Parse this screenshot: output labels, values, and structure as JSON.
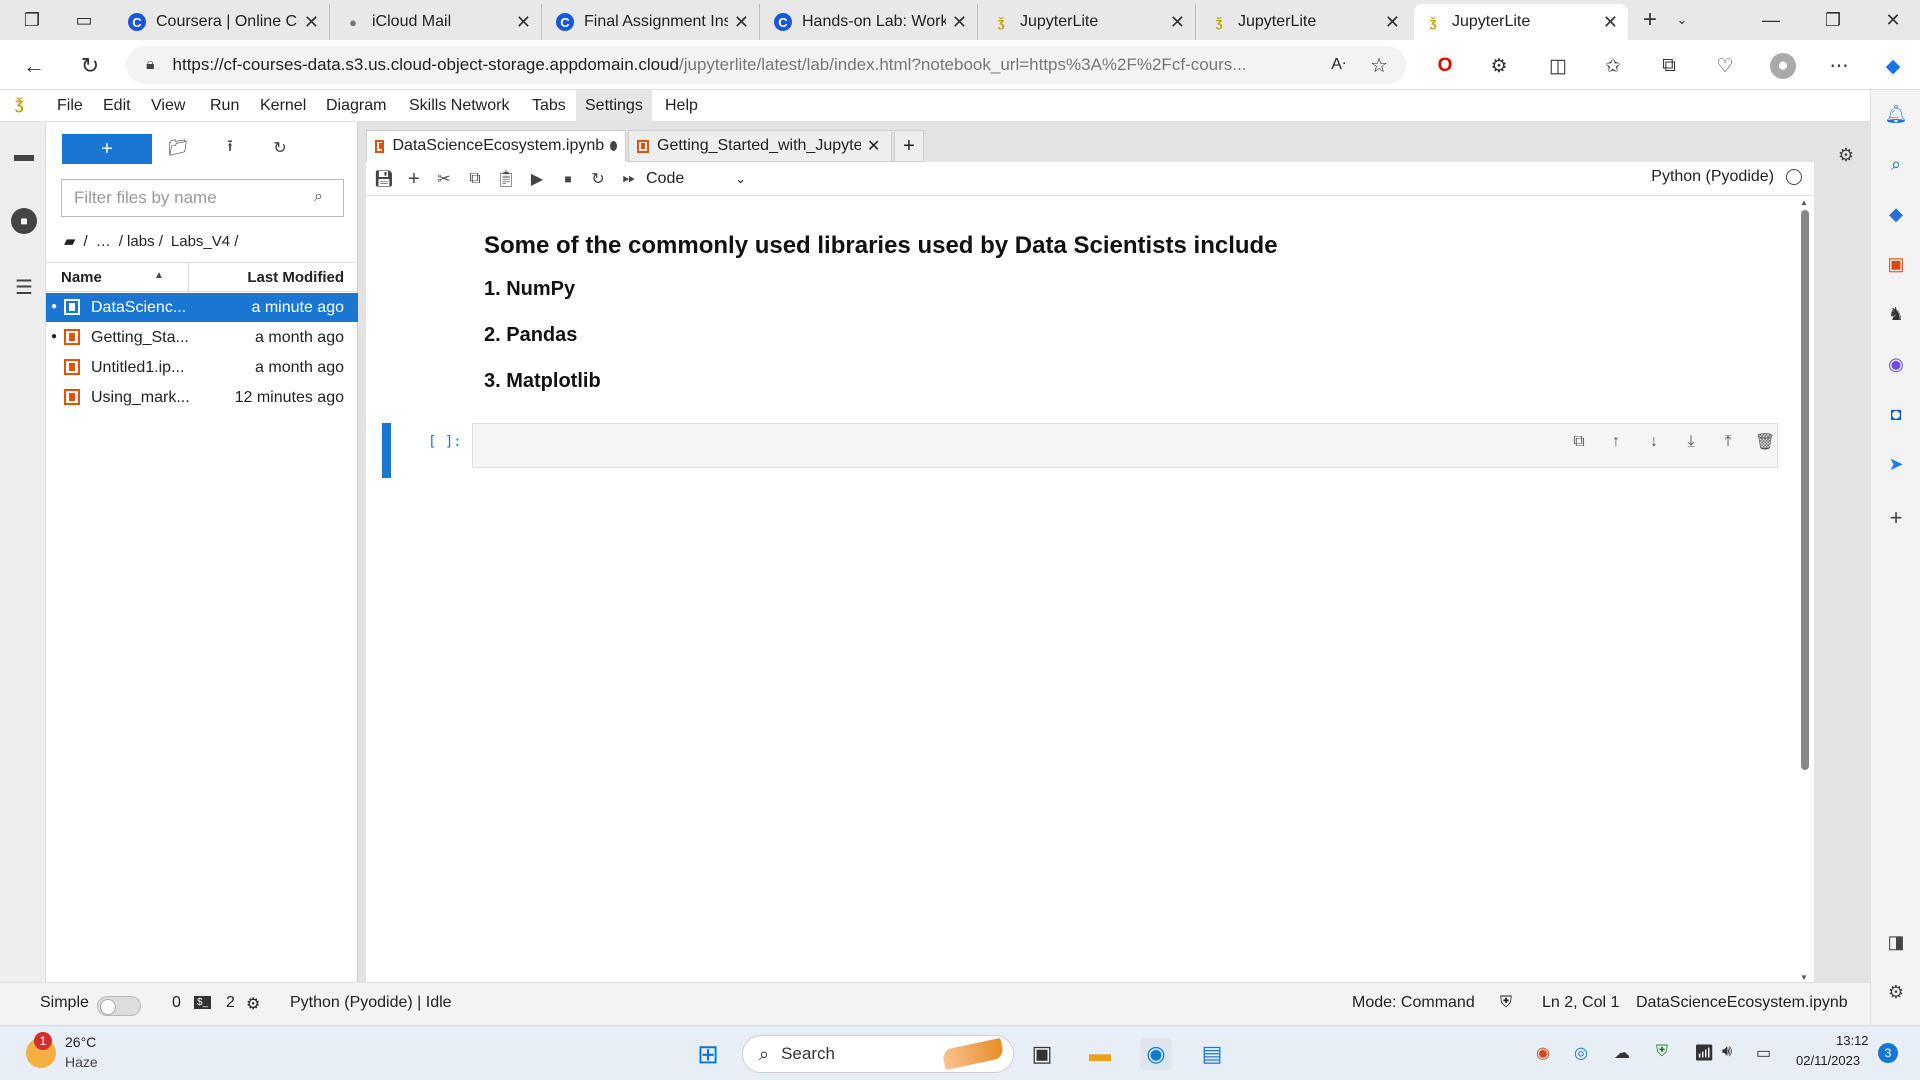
{
  "browser": {
    "tabs": [
      {
        "title": "Coursera | Online Cc",
        "favicon": "coursera-icon"
      },
      {
        "title": "iCloud Mail",
        "favicon": "apple-icon"
      },
      {
        "title": "Final Assignment Ins",
        "favicon": "coursera-icon"
      },
      {
        "title": "Hands-on Lab: Work",
        "favicon": "coursera-icon"
      },
      {
        "title": "JupyterLite",
        "favicon": "jupyter-icon"
      },
      {
        "title": "JupyterLite",
        "favicon": "jupyter-icon"
      },
      {
        "title": "JupyterLite",
        "favicon": "jupyter-icon",
        "active": true
      }
    ],
    "url_main": "https://cf-courses-data.s3.us.cloud-object-storage.appdomain.cloud",
    "url_rest": "/jupyterlite/latest/lab/index.html?notebook_url=https%3A%2F%2Fcf-cours..."
  },
  "jupyter": {
    "menu": [
      "File",
      "Edit",
      "View",
      "Run",
      "Kernel",
      "Diagram",
      "Skills Network",
      "Tabs",
      "Settings",
      "Help"
    ],
    "new_label": "+",
    "filter_placeholder": "Filter files by name",
    "breadcrumb": {
      "root": "/",
      "ellipsis": "…",
      "p1": "/ labs /",
      "p2": "Labs_V4 /"
    },
    "file_headers": {
      "name": "Name",
      "modified": "Last Modified"
    },
    "files": [
      {
        "name": "DataScienc...",
        "modified": "a minute ago",
        "running": true,
        "selected": true
      },
      {
        "name": "Getting_Sta...",
        "modified": "a month ago",
        "running": true
      },
      {
        "name": "Untitled1.ip...",
        "modified": "a month ago"
      },
      {
        "name": "Using_mark...",
        "modified": "12 minutes ago"
      }
    ],
    "doc_tabs": [
      {
        "title": "DataScienceEcosystem.ipynb",
        "active": true
      },
      {
        "title": "Getting_Started_with_Jupyter"
      }
    ],
    "cell_type": "Code",
    "kernel_name": "Python (Pyodide)",
    "markdown": {
      "heading": "Some of the commonly used libraries used by Data Scientists include",
      "items": [
        "1. NumPy",
        "2. Pandas",
        "3. Matplotlib"
      ]
    },
    "code_prompt": "[ ]:",
    "status": {
      "mode_label": "Simple",
      "terminals": "0",
      "kernels": "2",
      "kernel_status": "Python (Pyodide) | Idle",
      "mode": "Mode: Command",
      "cursor": "Ln 2, Col 1",
      "file": "DataScienceEcosystem.ipynb"
    }
  },
  "taskbar": {
    "weather_temp": "26°C",
    "weather_desc": "Haze",
    "weather_badge": "1",
    "search": "Search",
    "time": "13:12",
    "date": "02/11/2023",
    "notif_count": "3"
  }
}
